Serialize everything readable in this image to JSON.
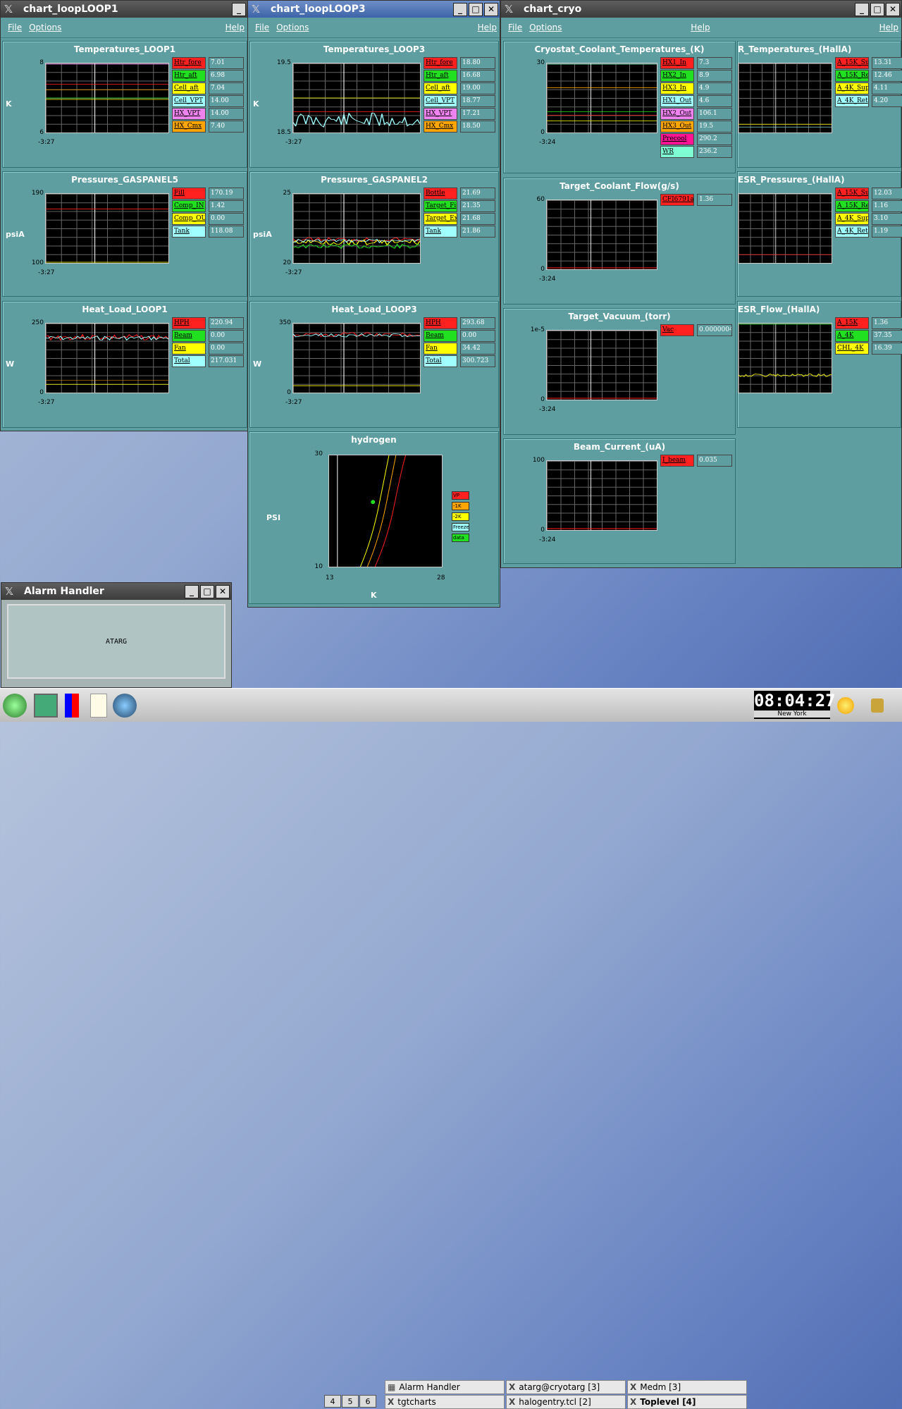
{
  "windows": [
    {
      "title": "chart_loopLOOP1",
      "menu": [
        "File",
        "Options"
      ],
      "help": "Help"
    },
    {
      "title": "chart_loopLOOP3",
      "menu": [
        "File",
        "Options"
      ],
      "help": "Help"
    },
    {
      "title": "chart_cryo",
      "menu": [
        "File",
        "Options"
      ],
      "help": "Help"
    }
  ],
  "panels": [
    {
      "id": "p1",
      "title": "Temperatures_LOOP1",
      "unit": "K",
      "ymax": "8",
      "ymin": "6",
      "time": "-3:27",
      "legend": [
        [
          "Htr_fore",
          "7.01",
          "#ff2020"
        ],
        [
          "Htr_aft",
          "6.98",
          "#20e020"
        ],
        [
          "Cell_aft",
          "7.04",
          "#ffff00"
        ],
        [
          "Cell_VPT",
          "14.00",
          "#a0ffff"
        ],
        [
          "HX_VPT",
          "14.00",
          "#ee82ee"
        ],
        [
          "HX_Cmx",
          "7.40",
          "#ffa500"
        ]
      ]
    },
    {
      "id": "p2",
      "title": "Pressures_GASPANEL5",
      "unit": "psiA",
      "ymax": "190",
      "ymin": "100",
      "time": "-3:27",
      "legend": [
        [
          "Fill",
          "170.19",
          "#ff2020"
        ],
        [
          "Comp_IN",
          "1.42",
          "#20e020"
        ],
        [
          "Comp_OU",
          "0.00",
          "#ffff00"
        ],
        [
          "Tank",
          "118.08",
          "#a0ffff"
        ]
      ]
    },
    {
      "id": "p3",
      "title": "Heat_Load_LOOP1",
      "unit": "W",
      "ymax": "250",
      "ymin": "0",
      "time": "-3:27",
      "legend": [
        [
          "HPH",
          "220.94",
          "#ff2020"
        ],
        [
          "Beam",
          "0.00",
          "#20e020"
        ],
        [
          "Fan",
          "0.00",
          "#ffff00"
        ],
        [
          "Total",
          "217.031",
          "#a0ffff"
        ]
      ]
    },
    {
      "id": "p4",
      "title": "Temperatures_LOOP3",
      "unit": "K",
      "ymax": "19.5",
      "ymin": "18.5",
      "time": "-3:27",
      "legend": [
        [
          "Htr_fore",
          "18.80",
          "#ff2020"
        ],
        [
          "Htr_aft",
          "16.68",
          "#20e020"
        ],
        [
          "Cell_aft",
          "19.00",
          "#ffff00"
        ],
        [
          "Cell_VPT",
          "18.77",
          "#a0ffff"
        ],
        [
          "HX_VPT",
          "17.21",
          "#ee82ee"
        ],
        [
          "HX_Cmx",
          "18.50",
          "#ffa500"
        ]
      ]
    },
    {
      "id": "p5",
      "title": "Pressures_GASPANEL2",
      "unit": "psiA",
      "ymax": "25",
      "ymin": "20",
      "time": "-3:27",
      "legend": [
        [
          "Bottle",
          "21.69",
          "#ff2020"
        ],
        [
          "Target_Fi",
          "21.35",
          "#20e020"
        ],
        [
          "Target_Ex",
          "21.68",
          "#ffff00"
        ],
        [
          "Tank",
          "21.86",
          "#a0ffff"
        ]
      ]
    },
    {
      "id": "p6",
      "title": "Heat_Load_LOOP3",
      "unit": "W",
      "ymax": "350",
      "ymin": "0",
      "time": "-3:27",
      "legend": [
        [
          "HPH",
          "293.68",
          "#ff2020"
        ],
        [
          "Beam",
          "0.00",
          "#20e020"
        ],
        [
          "Fan",
          "34.42",
          "#ffff00"
        ],
        [
          "Total",
          "300.723",
          "#a0ffff"
        ]
      ]
    },
    {
      "id": "p7",
      "title": "Cryostat_Coolant_Temperatures_(K)",
      "unit": "",
      "ymax": "30",
      "ymin": "0",
      "time": "-3:24",
      "legend": [
        [
          "HX1_In",
          "7.3",
          "#ff2020"
        ],
        [
          "HX2_In",
          "8.9",
          "#20e020"
        ],
        [
          "HX3_In",
          "4.9",
          "#ffff00"
        ],
        [
          "HX1_Out",
          "4.6",
          "#a0ffff"
        ],
        [
          "HX2_Out",
          "106.1",
          "#ee82ee"
        ],
        [
          "HX3_Out",
          "19.5",
          "#ffa500"
        ],
        [
          "Precool",
          "290.2",
          "#ff1493"
        ],
        [
          "WR",
          "236.2",
          "#7fffd4"
        ]
      ]
    },
    {
      "id": "p8",
      "title": "Target_Coolant_Flow(g/s)",
      "unit": "",
      "ymax": "60",
      "ymin": "0",
      "time": "-3:24",
      "legend": [
        [
          "CFI6791a",
          "1.36",
          "#ff2020"
        ]
      ]
    },
    {
      "id": "p9",
      "title": "Target_Vacuum_(torr)",
      "unit": "",
      "ymax": "1e-5",
      "ymin": "0",
      "time": "-3:24",
      "legend": [
        [
          "Vac",
          "0.0000004",
          "#ff2020"
        ]
      ]
    },
    {
      "id": "p10",
      "title": "Beam_Current_(uA)",
      "unit": "",
      "ymax": "100",
      "ymin": "0",
      "time": "-3:24",
      "legend": [
        [
          "I_beam",
          "0.035",
          "#ff2020"
        ]
      ]
    },
    {
      "id": "p11",
      "title": "R_Temperatures_(HallA)",
      "unit": "",
      "ymax": "",
      "ymin": "",
      "time": "",
      "legend": [
        [
          "A_15K_Su",
          "13.31",
          "#ff2020"
        ],
        [
          "A_15K_Re",
          "12.46",
          "#20e020"
        ],
        [
          "A_4K_Sup",
          "4.11",
          "#ffff00"
        ],
        [
          "A_4K_Ret",
          "4.20",
          "#a0ffff"
        ]
      ]
    },
    {
      "id": "p12",
      "title": "ESR_Pressures_(HallA)",
      "unit": "",
      "ymax": "",
      "ymin": "",
      "time": "",
      "legend": [
        [
          "A_15K_Su",
          "12.03",
          "#ff2020"
        ],
        [
          "A_15K_Re",
          "1.16",
          "#20e020"
        ],
        [
          "A_4K_Sup",
          "3.10",
          "#ffff00"
        ],
        [
          "A_4K_Ret",
          "1.19",
          "#a0ffff"
        ]
      ]
    },
    {
      "id": "p13",
      "title": "ESR_Flow_(HallA)",
      "unit": "",
      "ymax": "",
      "ymin": "",
      "time": "",
      "legend": [
        [
          "A_15K",
          "1.36",
          "#ff2020"
        ],
        [
          "A_4K",
          "37.35",
          "#20e020"
        ],
        [
          "CHL_4K",
          "16.39",
          "#ffff00"
        ]
      ]
    }
  ],
  "hydrogen": {
    "title": "hydrogen",
    "unit_y": "PSI",
    "unit_x": "K",
    "ymax": "30",
    "ymin": "10",
    "xmin": "13",
    "xmax": "28",
    "legend": [
      [
        "VP",
        "#ff2020"
      ],
      [
        "-1K",
        "#ffa500"
      ],
      [
        "-2K",
        "#ffff00"
      ],
      [
        "Freeze",
        "#a0ffff"
      ],
      [
        "data",
        "#20e020"
      ]
    ]
  },
  "alarm": {
    "title": "Alarm Handler",
    "label": "ATARG"
  },
  "taskbar": {
    "pager": [
      "4",
      "5",
      "6"
    ],
    "tasks": [
      "Alarm Handler",
      "atarg@cryotarg [3]",
      "Medm [3]",
      "tgtcharts",
      "halogentry.tcl [2]",
      "Toplevel [4]"
    ],
    "clock": "08:04:27",
    "city": "New York"
  }
}
